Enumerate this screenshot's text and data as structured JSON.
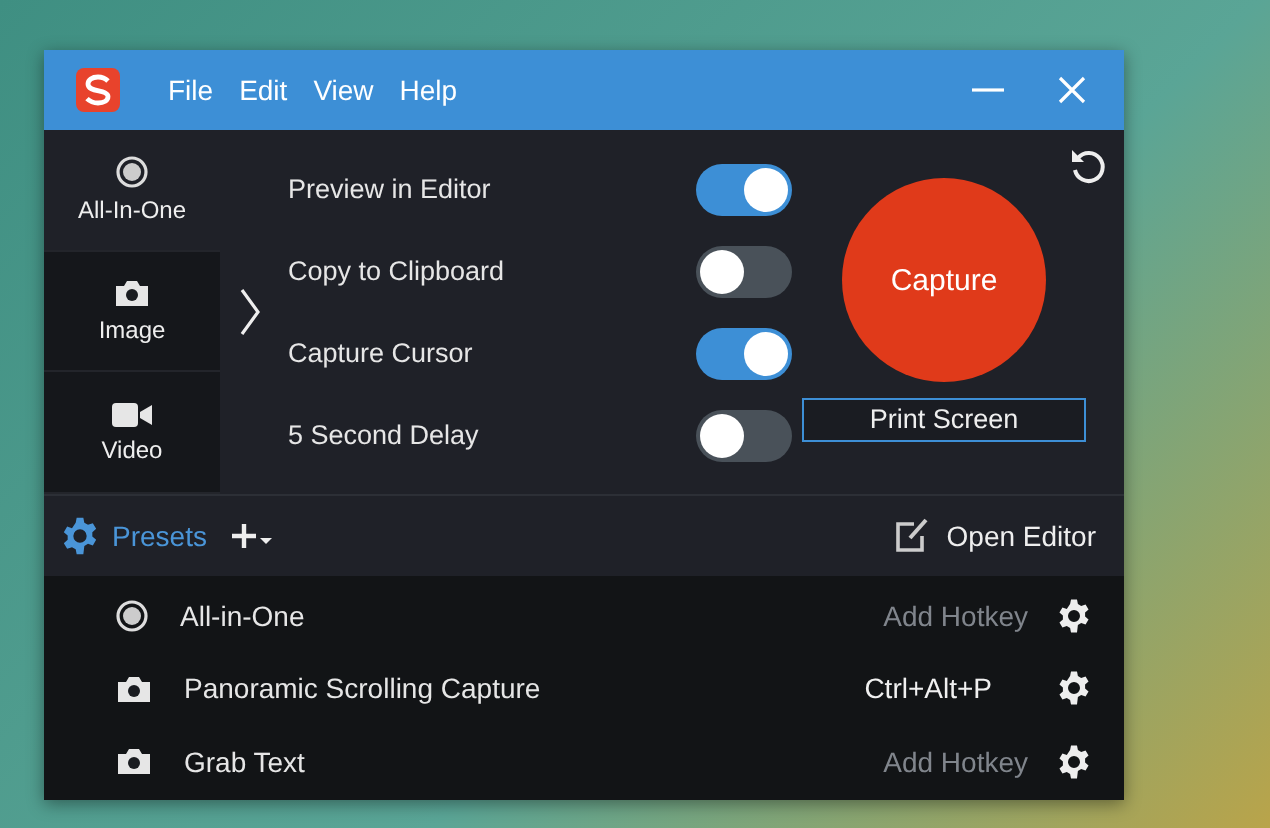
{
  "window": {
    "menu": [
      "File",
      "Edit",
      "View",
      "Help"
    ]
  },
  "capture_types": [
    {
      "label": "All-In-One",
      "kind": "all-in-one",
      "selected": true
    },
    {
      "label": "Image",
      "kind": "image",
      "selected": false
    },
    {
      "label": "Video",
      "kind": "video",
      "selected": false
    }
  ],
  "options": [
    {
      "label": "Preview in Editor",
      "on": true
    },
    {
      "label": "Copy to Clipboard",
      "on": false
    },
    {
      "label": "Capture Cursor",
      "on": true
    },
    {
      "label": "5 Second Delay",
      "on": false
    }
  ],
  "capture_button": "Capture",
  "hotkey_field": "Print Screen",
  "presets_bar": {
    "label": "Presets",
    "open_editor": "Open Editor"
  },
  "presets": [
    {
      "name": "All-in-One",
      "kind": "all-in-one",
      "hotkey": "Add Hotkey",
      "hotkey_assigned": false
    },
    {
      "name": "Panoramic Scrolling Capture",
      "kind": "image",
      "hotkey": "Ctrl+Alt+P",
      "hotkey_assigned": true
    },
    {
      "name": "Grab Text",
      "kind": "image",
      "hotkey": "Add Hotkey",
      "hotkey_assigned": false
    }
  ]
}
